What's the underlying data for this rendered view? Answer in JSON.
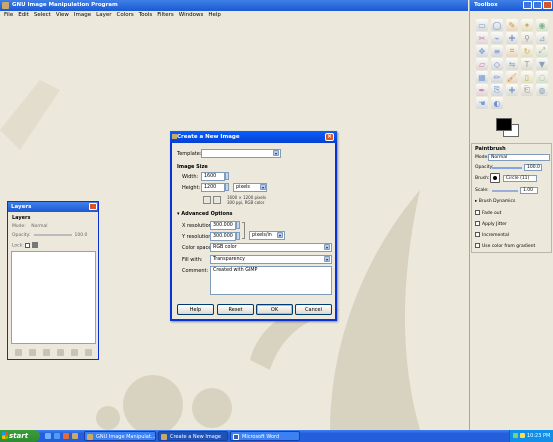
{
  "main_window": {
    "title": "GNU Image Manipulation Program",
    "menu": [
      "File",
      "Edit",
      "Select",
      "View",
      "Image",
      "Layer",
      "Colors",
      "Tools",
      "Filters",
      "Windows",
      "Help"
    ]
  },
  "toolbox": {
    "title": "Toolbox",
    "menu": [
      "File",
      "Xtns",
      "Help"
    ],
    "tools": [
      "rect-select",
      "ellipse-select",
      "free-select",
      "fuzzy-select",
      "select-by-color",
      "scissors",
      "paths",
      "color-picker",
      "zoom",
      "measure",
      "move",
      "align",
      "crop",
      "rotate",
      "scale",
      "shear",
      "perspective",
      "flip",
      "text",
      "bucket-fill",
      "blend",
      "pencil",
      "paintbrush",
      "eraser",
      "airbrush",
      "ink",
      "clone",
      "heal",
      "perspective-clone",
      "blur",
      "smudge",
      "dodge-burn"
    ],
    "options": {
      "header": "Paintbrush",
      "mode_label": "Mode:",
      "mode_value": "Normal",
      "opacity_label": "Opacity:",
      "opacity_value": "100.0",
      "brush_label": "Brush:",
      "brush_value": "Circle (11)",
      "scale_label": "Scale:",
      "scale_value": "1.00",
      "checkboxes": [
        "Brush Dynamics",
        "Fade out",
        "Apply Jitter",
        "Incremental",
        "Use color from gradient"
      ]
    }
  },
  "layers": {
    "title": "Layers",
    "header": "Layers",
    "mode_label": "Mode:",
    "mode_value": "Normal",
    "opacity_label": "Opacity:",
    "opacity_value": "100.0",
    "lock_label": "Lock:"
  },
  "dialog": {
    "title": "Create a New Image",
    "template_label": "Template:",
    "template_value": "",
    "image_size_label": "Image Size",
    "width_label": "Width:",
    "width_value": "1600",
    "height_label": "Height:",
    "height_value": "1200",
    "unit": "pixels",
    "info_line1": "1600 × 1200 pixels",
    "info_line2": "300 ppi, RGB color",
    "advanced_label": "Advanced Options",
    "xres_label": "X resolution:",
    "xres_value": "300.000",
    "yres_label": "Y resolution:",
    "yres_value": "300.000",
    "res_unit": "pixels/in",
    "colorspace_label": "Color space:",
    "colorspace_value": "RGB color",
    "fill_label": "Fill with:",
    "fill_value": "Transparency",
    "comment_label": "Comment:",
    "comment_value": "Created with GIMP",
    "buttons": {
      "help": "Help",
      "reset": "Reset",
      "ok": "OK",
      "cancel": "Cancel"
    }
  },
  "taskbar": {
    "start": "start",
    "tasks": [
      "GNU Image Manipulat...",
      "Create a New Image",
      "Microsoft Word"
    ],
    "clock": "10:23 PM"
  }
}
